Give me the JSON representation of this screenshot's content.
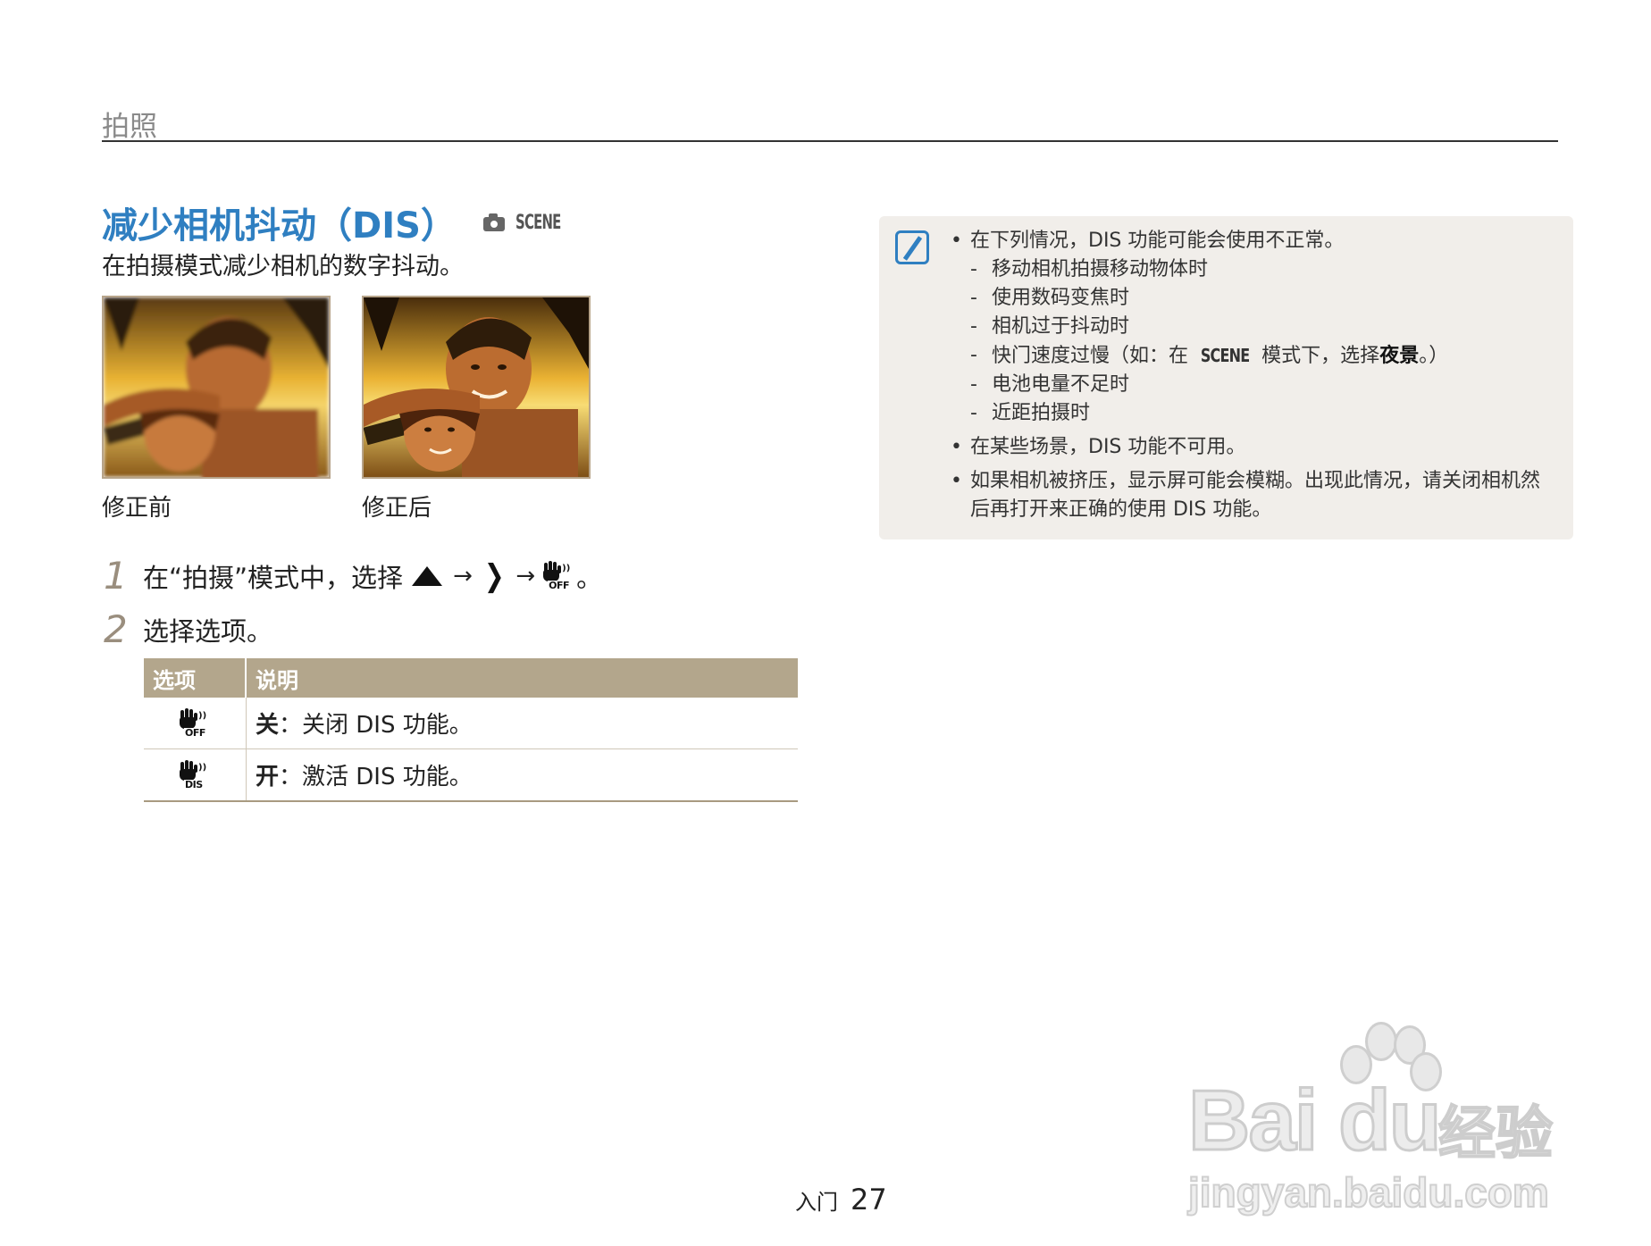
{
  "header": {
    "section": "拍照"
  },
  "title": {
    "text": "减少相机抖动（DIS）",
    "mode_scene": "SCENE"
  },
  "subtitle": "在拍摄模式减少相机的数字抖动。",
  "photos": {
    "before_caption": "修正前",
    "after_caption": "修正后"
  },
  "steps": {
    "step1": {
      "num": "1",
      "prefix": "在“拍摄”模式中，选择",
      "arrow": "→",
      "end": "。",
      "icon_tag": "OFF"
    },
    "step2": {
      "num": "2",
      "text": "选择选项。"
    }
  },
  "table": {
    "headers": [
      "选项",
      "说明"
    ],
    "rows": [
      {
        "icon": "dis-off-icon",
        "icon_tag": "OFF",
        "label": "关",
        "desc": "：关闭 DIS 功能。"
      },
      {
        "icon": "dis-on-icon",
        "icon_tag": "DIS",
        "label": "开",
        "desc": "：激活 DIS 功能。"
      }
    ]
  },
  "note": {
    "b1": "在下列情况，DIS 功能可能会使用不正常。",
    "subs": [
      "移动相机拍摄移动物体时",
      "使用数码变焦时",
      "相机过于抖动时"
    ],
    "sub4_pre": "快门速度过慢（如：在",
    "sub4_scene": "SCENE",
    "sub4_mid": "模式下，选择",
    "sub4_bold": "夜景",
    "sub4_end": "。）",
    "subs2": [
      "电池电量不足时",
      "近距拍摄时"
    ],
    "b2": "在某些场景，DIS 功能不可用。",
    "b3": "如果相机被挤压，显示屏可能会模糊。出现此情况，请关闭相机然后再打开来正确的使用 DIS 功能。"
  },
  "footer": {
    "section": "入门",
    "page": "27"
  },
  "watermark": {
    "brand": "Bai du",
    "cn": "经验",
    "url": "jingyan.baidu.com"
  },
  "colors": {
    "accent": "#2f7fc1",
    "table_header": "#b3a68c",
    "note_bg": "#f1eeea"
  }
}
